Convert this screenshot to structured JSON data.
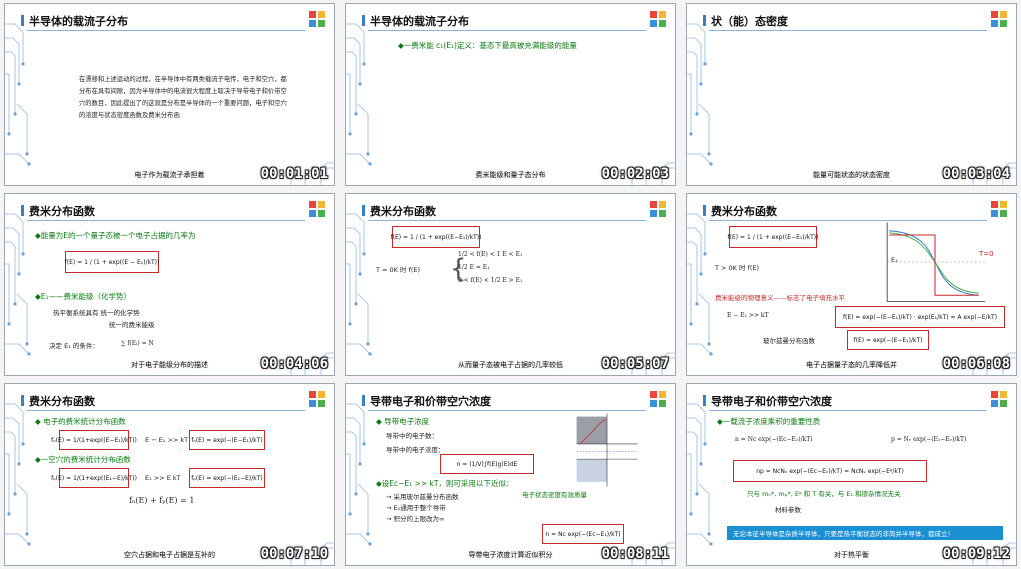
{
  "colors": {
    "accent": "#3a7fc1",
    "bullet": "#0a7a10",
    "formula_border": "#c72a2a",
    "banner": "#1a8fd1"
  },
  "thumbs": [
    {
      "title": "半导体的载流子分布",
      "caption": "电子作为载流子承担着",
      "ts": "00:01:01",
      "paragraph": "在漂移和上述运动的过程，在半导体中有两类载流子电传，电子和空穴，都分布在具有间隙，因为半导体中的电流很大程度上取决于导带电子和价带空穴的数目，因此提出了的这就是分布是半导体的一个重要问题，电子和空穴的浓度与状态密度函数及费米分布函"
    },
    {
      "title": "半导体的载流子分布",
      "caption": "费米能级和量子态分布",
      "ts": "00:02:03",
      "bullet": "◆一费米能 c₁(E₁)定义：基态下最高被充满能级的能量"
    },
    {
      "title": "状（能）态密度",
      "caption": "能量可能状态的状态密度",
      "ts": "00:03:04"
    },
    {
      "title": "费米分布函数",
      "caption": "对于电子能级分布的描述",
      "ts": "00:04:06",
      "bullet": "◆能量为E的一个量子态被一个电子占据的几率为",
      "b2": "◆E₁——费米能级（化学势）",
      "l1": "热平衡系统具有 统一的化学势",
      "l2": "统一的费米能级",
      "l3": "决定 E₁ 的条件：",
      "formula": "f(E) = 1 / (1 + exp((E − E₁)/kT))",
      "sum": "∑ f(Eᵢ) = N"
    },
    {
      "title": "费米分布函数",
      "caption": "从而量子态被电子占据的几率较低",
      "ts": "00:05:07",
      "formula": "f(E) = 1 / (1 + exp((E−E₁)/kT))",
      "t0": "T = 0K 时  f(E)",
      "p1": "1/2 < f(E) < 1    E < E₁",
      "p2": "1/2        E = E₁",
      "p3": "0 < f(E) < 1/2    E > E₁"
    },
    {
      "title": "费米分布函数",
      "caption": "电子占据量子态的几率降低并",
      "ts": "00:06:08",
      "formula": "f(E) = 1 / (1 + exp((E−E₁)/kT))",
      "t0": "T > 0K 时  f(E)",
      "red": "费米能级的物理意义——标志了电子填充水平",
      "cond": "E − E₁ >> kT",
      "boltz_l": "玻尔兹曼分布函数",
      "boltz": "f(E) = exp(−(E−E₁)/kT)",
      "long": "f(E) = exp(−(E−E₁)/kT) · exp(E₁/kT) = A exp(−E/kT)",
      "t_label": "T=0",
      "e_label": "E₁"
    },
    {
      "title": "费米分布函数",
      "caption": "空穴占据和电子占据是互补的",
      "ts": "00:07:10",
      "b1": "◆ 电子的费米统计分布函数",
      "b2": "◆一空穴的费米统计分布函数",
      "f1": "fₙ(E) = 1/(1+exp((E−E₁)/kT))",
      "c1": "E − E₁ >> kT",
      "f2": "fₙ(E) = exp(−(E−E₁)/kT)",
      "f3": "fₚ(E) = 1/(1+exp((E₁−E)/kT))",
      "c2": "E₁ >> E kT",
      "f4": "fₚ(E) = exp(−(E₁−E)/kT)",
      "sum": "fₙ(E) + fₚ(E) = 1"
    },
    {
      "title": "导带电子和价带空穴浓度",
      "caption": "导带电子浓度计算近似积分",
      "ts": "00:08:11",
      "b1": "◆ 导带电子浓度",
      "l1": "导带中的电子数：",
      "l2": "导带中的电子浓度：",
      "b2": "◆设Ec−E₁ >> kT，则可采用以下近似：",
      "s1": "→ 采用玻尔兹曼分布函数",
      "s2": "→ E₁通用于整个导带",
      "s3": "→ 积分的上限改为∞",
      "green": "电子状态密度有效质量",
      "nform": "n = (1/V)∫f(E)g(E)dE",
      "nc": "n = Nᴄ exp(−(Eᴄ−E₁)/kT)"
    },
    {
      "title": "导带电子和价带空穴浓度",
      "caption": "对于热平衡",
      "ts": "00:09:12",
      "b1": "◆一载流子浓度乘积的重要性质",
      "m1": "n = Nᴄ exp(−(Eᴄ−E₁)/kT)",
      "m2": "p = Nᵥ exp(−(E₁−Eᵥ)/kT)",
      "np": "np = NᴄNᵥ exp(−(Eᴄ−Eᵥ)/kT) = NᴄNᵥ exp(−Eᵍ/kT)",
      "r1": "只与 mₙ*, mₚ*, Eᵍ 和 T 有关，与 E₁ 和掺杂情况无关",
      "r2": "材料参数",
      "banner": "无论本征半导体是杂质半导体，只要是热平衡状态的非简并半导体，都成立！"
    }
  ]
}
